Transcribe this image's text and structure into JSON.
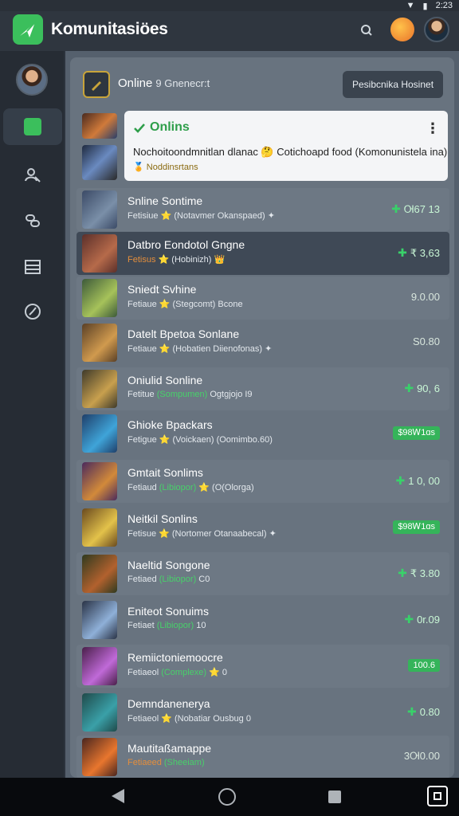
{
  "status": {
    "time": "2:23"
  },
  "app": {
    "title": "Komunitasiöes"
  },
  "header": {
    "title": "Online",
    "subtitle": "9 Gnenecr:t",
    "button": "Pesibcnika Hosinet"
  },
  "notice": {
    "title": "Onlins",
    "text": "Nochoitoondmnitlan dlanac 🤔 Cotichoapd food (Komonunistela ina)",
    "tag": "Noddinsrtans"
  },
  "rows": [
    {
      "name": "Snline Sontime",
      "sub_a": "Fetisiue",
      "sub_b": "⭐ (Notavmer Okanspaed)",
      "sub_c": "✦",
      "price": "Ꮊ67 13",
      "style": "up",
      "thumb": [
        "#3b4a66",
        "#7a8fa8"
      ]
    },
    {
      "name": "Datbro Eondotol Gngne",
      "sub_a": "Fetisus",
      "sub_b": "⭐ (Hobinizh)",
      "sub_c": "👑",
      "price": "₹ 3,63",
      "style": "up",
      "thumb": [
        "#5b2f2a",
        "#b66a4a"
      ]
    },
    {
      "name": "Sniedt Svhine",
      "sub_a": "Fetiaue",
      "sub_b": "⭐ (Stegcomt)",
      "sub_c": "Bcone",
      "price": "9.0.00",
      "style": "plain",
      "thumb": [
        "#3d5a3a",
        "#a6c25a"
      ]
    },
    {
      "name": "Datelt Bpetoa Sonlane",
      "sub_a": "Fetiaue",
      "sub_b": "⭐ (Hobatien Diienofonas)",
      "sub_c": "✦",
      "price": "S0.80",
      "style": "plain",
      "thumb": [
        "#5a4026",
        "#d09a4e"
      ]
    },
    {
      "name": "Oniulid Sonline",
      "sub_a": "Fetitue",
      "sub_b": "(Sompumen)",
      "sub_c": "Ogtgjojo I9",
      "price": "90, 6",
      "style": "up",
      "thumb": [
        "#3e3a2a",
        "#c8a04e"
      ]
    },
    {
      "name": "Ghioke Bpackars",
      "sub_a": "Fetigue",
      "sub_b": "⭐ (Voickaen)",
      "sub_c": "(Oomimbo.60)",
      "price": "$98Ꮃ1ɑs",
      "style": "pill",
      "thumb": [
        "#1f3f6a",
        "#3fa4d8"
      ]
    },
    {
      "name": "Gmtait Sonlims",
      "sub_a": "Fetiaud",
      "sub_b": "(Libiopor)",
      "sub_c": "⭐ (O(Olorga)",
      "price": "1 0, 00",
      "style": "up",
      "thumb": [
        "#4b2a5c",
        "#d28a3a"
      ]
    },
    {
      "name": "Neitkil Sonlins",
      "sub_a": "Fetisue",
      "sub_b": "⭐ (Nortomer Otanaabecal)",
      "sub_c": "✦",
      "price": "$98Ꮃ1ɑs",
      "style": "pill",
      "thumb": [
        "#6a4a1f",
        "#e3c24a"
      ]
    },
    {
      "name": "Naeltid Songone",
      "sub_a": "Fetiaed",
      "sub_b": "(Libiopor)",
      "sub_c": "C0",
      "price": "₹ 3.80",
      "style": "up",
      "thumb": [
        "#2f3a1f",
        "#b2612e"
      ]
    },
    {
      "name": "Eniteot Sonuims",
      "sub_a": "Fetiaet",
      "sub_b": "(Libiopor)",
      "sub_c": "10",
      "price": "0r.09",
      "style": "up",
      "thumb": [
        "#2a3346",
        "#8fb0d8"
      ]
    },
    {
      "name": "Remiictoniemoocre",
      "sub_a": "Fetiaeol",
      "sub_b": "(Complexe)",
      "sub_c": "⭐ 0",
      "price": "100.6",
      "style": "pill",
      "thumb": [
        "#4a1f4a",
        "#c06ad8"
      ]
    },
    {
      "name": "Demndanenerya",
      "sub_a": "Fetiaeol",
      "sub_b": "⭐ (Nobatiar Ousbug",
      "sub_c": "0",
      "price": "0.80",
      "style": "up",
      "thumb": [
        "#1f4a4a",
        "#3aa0a8"
      ]
    },
    {
      "name": "Mautitaßamappe",
      "sub_a": "Fetiaeed",
      "sub_b": "(Sheeiam)",
      "sub_c": "",
      "price": "3Ꮊ0.00",
      "style": "plain",
      "thumb": [
        "#4a261f",
        "#e8762e"
      ]
    }
  ]
}
